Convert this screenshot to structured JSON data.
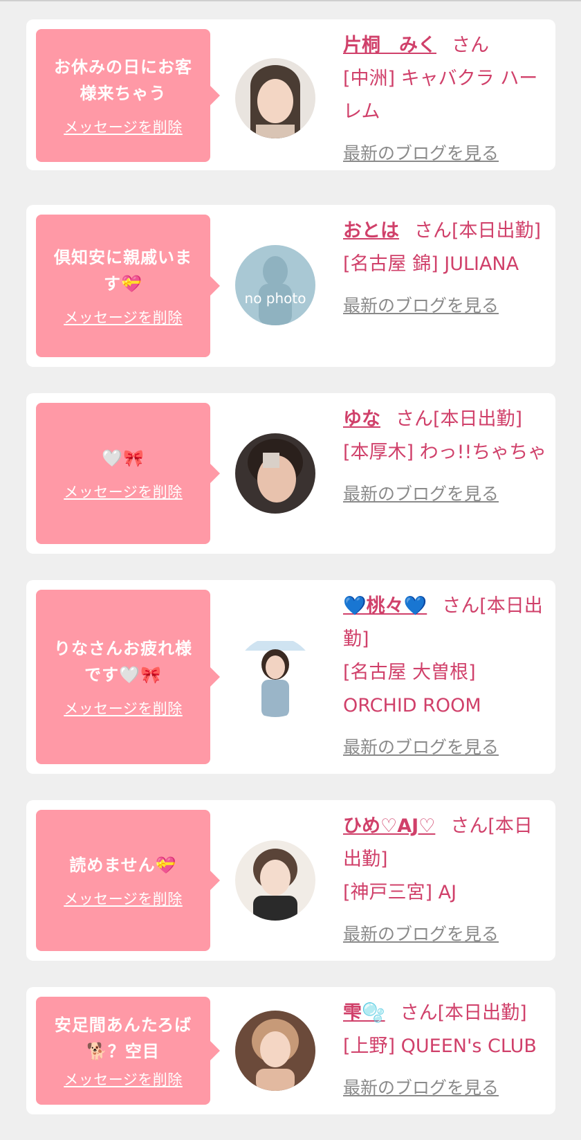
{
  "delete_label": "メッセージを削除",
  "blog_label": "最新のブログを見る",
  "san_label": "さん",
  "entries": [
    {
      "message": "お休みの日にお客様来ちゃう",
      "name": "片桐　みく",
      "status": "さん",
      "shop": "[中洲] キャバクラ ハーレム",
      "avatar": "photo-1"
    },
    {
      "message": "倶知安に親戚います💝",
      "name": "おとは",
      "status": "さん[本日出勤]",
      "shop": "[名古屋 錦] JULIANA",
      "avatar": "no-photo",
      "no_photo_text": "no photo"
    },
    {
      "message": "🤍🎀",
      "name": "ゆな",
      "status": "さん[本日出勤]",
      "shop": "[本厚木] わっ!!ちゃちゃ",
      "avatar": "photo-3"
    },
    {
      "message": "りなさんお疲れ様です🤍🎀",
      "name": "💙桃々💙",
      "status": "さん[本日出勤]",
      "shop": "[名古屋 大曽根] ORCHID ROOM",
      "avatar": "photo-4"
    },
    {
      "message": "読めません💝",
      "name": "ひめ♡AJ♡",
      "status": "さん[本日出勤]",
      "shop": "[神戸三宮] AJ",
      "avatar": "photo-5"
    },
    {
      "message": "安足間あんたろば🐕？空目",
      "name": "雫🫧",
      "status": "さん[本日出勤]",
      "shop": "[上野] QUEEN's CLUB",
      "avatar": "photo-6"
    }
  ],
  "colors": {
    "accent": "#d0406a",
    "bubble": "#ff99a6",
    "background": "#efefef",
    "link_gray": "#8a8a8a"
  }
}
